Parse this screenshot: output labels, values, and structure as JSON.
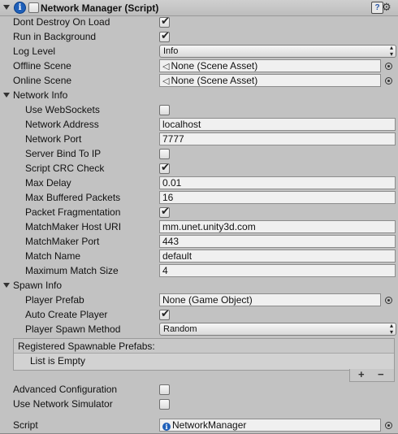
{
  "header": {
    "title": "Network Manager (Script)",
    "icon": "info-icon",
    "info_glyph": "i",
    "help_glyph": "?",
    "gear_glyph": "⚙"
  },
  "fields": {
    "dont_destroy_on_load": {
      "label": "Dont Destroy On Load",
      "checked": true
    },
    "run_in_background": {
      "label": "Run in Background",
      "checked": true
    },
    "log_level": {
      "label": "Log Level",
      "value": "Info"
    },
    "offline_scene": {
      "label": "Offline Scene",
      "value": "None (Scene Asset)"
    },
    "online_scene": {
      "label": "Online Scene",
      "value": "None (Scene Asset)"
    }
  },
  "network_info": {
    "section_label": "Network Info",
    "use_websockets": {
      "label": "Use WebSockets",
      "checked": false
    },
    "network_address": {
      "label": "Network Address",
      "value": "localhost"
    },
    "network_port": {
      "label": "Network Port",
      "value": "7777"
    },
    "server_bind_to_ip": {
      "label": "Server Bind To IP",
      "checked": false
    },
    "script_crc_check": {
      "label": "Script CRC Check",
      "checked": true
    },
    "max_delay": {
      "label": "Max Delay",
      "value": "0.01"
    },
    "max_buffered_packets": {
      "label": "Max Buffered Packets",
      "value": "16"
    },
    "packet_fragmentation": {
      "label": "Packet Fragmentation",
      "checked": true
    },
    "matchmaker_host_uri": {
      "label": "MatchMaker Host URI",
      "value": "mm.unet.unity3d.com"
    },
    "matchmaker_port": {
      "label": "MatchMaker Port",
      "value": "443"
    },
    "match_name": {
      "label": "Match Name",
      "value": "default"
    },
    "maximum_match_size": {
      "label": "Maximum Match Size",
      "value": "4"
    }
  },
  "spawn_info": {
    "section_label": "Spawn Info",
    "player_prefab": {
      "label": "Player Prefab",
      "value": "None (Game Object)"
    },
    "auto_create_player": {
      "label": "Auto Create Player",
      "checked": true
    },
    "player_spawn_method": {
      "label": "Player Spawn Method",
      "value": "Random"
    },
    "registered_prefabs": {
      "header": "Registered Spawnable Prefabs:",
      "empty_text": "List is Empty",
      "add_glyph": "+",
      "remove_glyph": "−"
    }
  },
  "advanced": {
    "advanced_configuration": {
      "label": "Advanced Configuration",
      "checked": false
    },
    "use_network_simulator": {
      "label": "Use Network Simulator",
      "checked": false
    }
  },
  "script": {
    "label": "Script",
    "value": "NetworkManager",
    "icon_glyph": "i"
  },
  "glyphs": {
    "check": "✔",
    "scene_asset": "◁",
    "dropdown_arrows": "▴▾"
  }
}
